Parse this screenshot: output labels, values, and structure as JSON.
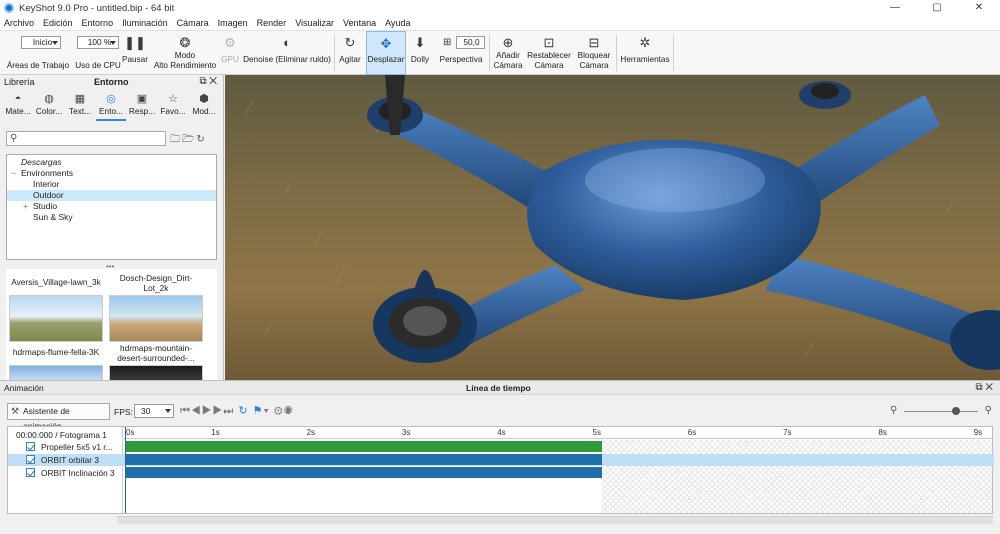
{
  "window": {
    "title": "KeyShot 9.0 Pro  -  untitled.bip  -  64 bit",
    "minimize": "—",
    "maximize": "▢",
    "close": "✕"
  },
  "menu": [
    "Archivo",
    "Edición",
    "Entorno",
    "Iluminación",
    "Cámara",
    "Imagen",
    "Render",
    "Visualizar",
    "Ventana",
    "Ayuda"
  ],
  "toolbar": {
    "workspace_value": "Inicio",
    "workspace_label": "Áreas de Trabajo",
    "cpu_value": "100 %",
    "cpu_label": "Uso de CPU",
    "pause_label": "Pausar",
    "perf_mode_label_1": "Modo",
    "perf_mode_label_2": "Alto Rendimiento",
    "gpu_label": "GPU",
    "denoise_label": "Denoise (Eliminar ruido)",
    "tumble_label": "Agitar",
    "pan_label": "Desplazar",
    "dolly_label": "Dolly",
    "perspective_value": "50,0",
    "perspective_label": "Perspectiva",
    "add_camera_label_1": "Añadir",
    "add_camera_label_2": "Cámara",
    "reset_camera_label_1": "Restablecer",
    "reset_camera_label_2": "Cámara",
    "lock_camera_label_1": "Bloquear",
    "lock_camera_label_2": "Cámara",
    "tools_label": "Herramientas"
  },
  "library": {
    "header_left": "Librería",
    "header_title": "Entorno",
    "tabs": [
      {
        "label": "Mate...",
        "icon": "materials-icon"
      },
      {
        "label": "Color...",
        "icon": "colors-icon"
      },
      {
        "label": "Text...",
        "icon": "textures-icon"
      },
      {
        "label": "Ento...",
        "icon": "environments-icon"
      },
      {
        "label": "Resp...",
        "icon": "backplates-icon"
      },
      {
        "label": "Favo...",
        "icon": "favorites-icon"
      },
      {
        "label": "Mod...",
        "icon": "models-icon"
      }
    ],
    "search_placeholder": "",
    "tree": [
      {
        "label": "Descargas",
        "level": 0,
        "italic": true
      },
      {
        "label": "Environments",
        "level": 0,
        "expander": "−"
      },
      {
        "label": "Interior",
        "level": 1
      },
      {
        "label": "Outdoor",
        "level": 1,
        "selected": true
      },
      {
        "label": "Studio",
        "level": 1,
        "expander": "+"
      },
      {
        "label": "Sun & Sky",
        "level": 1
      }
    ],
    "thumbnails": [
      {
        "label": "Aversis_Village-lawn_3k"
      },
      {
        "label": "Dosch-Design_Dirt-Lot_2k"
      },
      {
        "label": "hdrmaps-flume-fella-3K"
      },
      {
        "label": "hdrmaps-mountain-desert-surrounded-..."
      }
    ]
  },
  "animation": {
    "panel_title": "Animación",
    "timeline_title": "Línea de tiempo",
    "wizard_label": "Asistente de animación",
    "fps_label": "FPS:",
    "fps_value": "30",
    "time_display": "00:00:000 / Fotograma 1",
    "ruler": [
      "0s",
      "1s",
      "2s",
      "3s",
      "4s",
      "5s",
      "6s",
      "7s",
      "8s",
      "9s"
    ],
    "tracks": [
      {
        "label": "Propeller 5x5 v1 r...",
        "color": "green",
        "selected": false
      },
      {
        "label": "ORBIT orbitar 3",
        "color": "blue",
        "selected": true
      },
      {
        "label": "ORBIT Inclinación 3",
        "color": "blue",
        "selected": false
      }
    ],
    "clip_duration_s": 5,
    "timeline_length_s": 9,
    "zoom_level": 0.7
  },
  "colors": {
    "accent": "#3b86d7",
    "green_track": "#2f9b3a",
    "blue_track": "#1f6fa8",
    "selection": "#cde8fb"
  }
}
